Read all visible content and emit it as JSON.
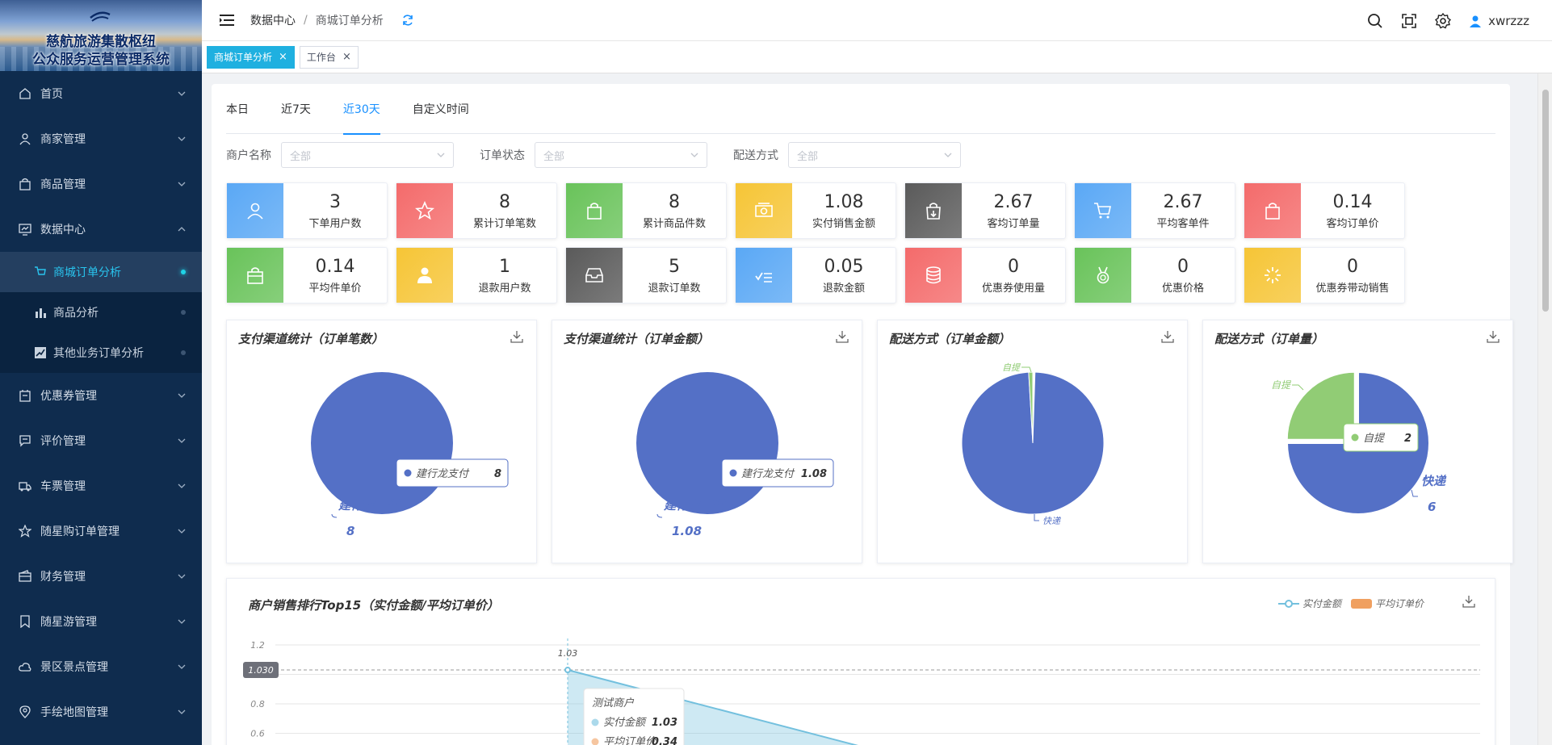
{
  "app": {
    "title_line1": "慈航旅游集散枢纽",
    "title_line2": "公众服务运营管理系统"
  },
  "sidebar": {
    "items": [
      {
        "label": "首页",
        "icon": "home-icon"
      },
      {
        "label": "商家管理",
        "icon": "user-icon"
      },
      {
        "label": "商品管理",
        "icon": "bag-icon"
      },
      {
        "label": "数据中心",
        "icon": "chart-icon",
        "expanded": true
      },
      {
        "label": "优惠券管理",
        "icon": "coupon-icon"
      },
      {
        "label": "评价管理",
        "icon": "comment-icon"
      },
      {
        "label": "车票管理",
        "icon": "truck-icon"
      },
      {
        "label": "随星购订单管理",
        "icon": "star-icon"
      },
      {
        "label": "财务管理",
        "icon": "wallet-icon"
      },
      {
        "label": "随星游管理",
        "icon": "bookmark-icon"
      },
      {
        "label": "景区景点管理",
        "icon": "cloud-icon"
      },
      {
        "label": "手绘地图管理",
        "icon": "location-icon"
      }
    ],
    "sub_items": [
      {
        "label": "商城订单分析",
        "active": true
      },
      {
        "label": "商品分析"
      },
      {
        "label": "其他业务订单分析"
      }
    ]
  },
  "header": {
    "breadcrumb_root": "数据中心",
    "breadcrumb_sep": "/",
    "breadcrumb_current": "商城订单分析",
    "username": "xwrzzz"
  },
  "tags": [
    {
      "label": "商城订单分析",
      "active": true,
      "close": "×"
    },
    {
      "label": "工作台",
      "active": false,
      "close": "×"
    }
  ],
  "tabs": [
    "本日",
    "近7天",
    "近30天",
    "自定义时间"
  ],
  "active_tab": "近30天",
  "filters": [
    {
      "label": "商户名称",
      "placeholder": "全部"
    },
    {
      "label": "订单状态",
      "placeholder": "全部"
    },
    {
      "label": "配送方式",
      "placeholder": "全部"
    }
  ],
  "stats": [
    {
      "value": "3",
      "name": "下单用户数",
      "color": "#5aa8f5",
      "icon": "user-icon"
    },
    {
      "value": "8",
      "name": "累计订单笔数",
      "color": "#f46b6b",
      "icon": "star-icon"
    },
    {
      "value": "8",
      "name": "累计商品件数",
      "color": "#69c35a",
      "icon": "bag-icon"
    },
    {
      "value": "1.08",
      "name": "实付销售金额",
      "color": "#f6c536",
      "icon": "money-icon"
    },
    {
      "value": "2.67",
      "name": "客均订单量",
      "color": "#5a5a5a",
      "icon": "bag-down-icon"
    },
    {
      "value": "2.67",
      "name": "平均客单件",
      "color": "#5aa8f5",
      "icon": "cart-icon"
    },
    {
      "value": "0.14",
      "name": "客均订单价",
      "color": "#f46b6b",
      "icon": "bag-icon"
    },
    {
      "value": "0.14",
      "name": "平均件单价",
      "color": "#69c35a",
      "icon": "shop-bag-icon"
    },
    {
      "value": "1",
      "name": "退款用户数",
      "color": "#f6c536",
      "icon": "person-icon"
    },
    {
      "value": "5",
      "name": "退款订单数",
      "color": "#5a5a5a",
      "icon": "inbox-icon"
    },
    {
      "value": "0.05",
      "name": "退款金额",
      "color": "#5aa8f5",
      "icon": "check-list-icon"
    },
    {
      "value": "0",
      "name": "优惠券使用量",
      "color": "#f46b6b",
      "icon": "database-icon"
    },
    {
      "value": "0",
      "name": "优惠价格",
      "color": "#69c35a",
      "icon": "medal-icon"
    },
    {
      "value": "0",
      "name": "优惠券带动销售",
      "color": "#f6c536",
      "icon": "loading-icon"
    }
  ],
  "chart_data": [
    {
      "type": "pie",
      "title": "支付渠道统计（订单笔数）",
      "slices": [
        {
          "name": "建行龙支付",
          "value": 8,
          "color": "#5470c6"
        }
      ],
      "tooltip": {
        "name": "建行龙支付",
        "value": "8"
      },
      "label": {
        "name": "建行龙支付",
        "value": "8"
      }
    },
    {
      "type": "pie",
      "title": "支付渠道统计（订单金额）",
      "slices": [
        {
          "name": "建行龙支付",
          "value": 1.08,
          "color": "#5470c6"
        }
      ],
      "tooltip": {
        "name": "建行龙支付",
        "value": "1.08"
      },
      "label": {
        "name": "建行龙支付",
        "value": "1.08"
      }
    },
    {
      "type": "pie",
      "title": "配送方式（订单金额）",
      "slices": [
        {
          "name": "快递",
          "value": 1.07,
          "color": "#5470c6"
        },
        {
          "name": "自提",
          "value": 0.01,
          "color": "#91cc75"
        }
      ]
    },
    {
      "type": "pie",
      "title": "配送方式（订单量）",
      "slices": [
        {
          "name": "快递",
          "value": 6,
          "color": "#5470c6"
        },
        {
          "name": "自提",
          "value": 2,
          "color": "#91cc75"
        }
      ],
      "tooltip": {
        "name": "自提",
        "value": "2"
      },
      "label": {
        "name": "快递",
        "value": "6"
      }
    },
    {
      "type": "line",
      "title": "商户销售排行Top15（实付金额/平均订单价）",
      "series": [
        {
          "name": "实付金额",
          "values": [
            1.03
          ],
          "color": "#73c0de"
        },
        {
          "name": "平均订单价",
          "values": [
            0.34
          ],
          "color": "#f0a060"
        }
      ],
      "categories": [
        "测试商户"
      ],
      "y_ticks": [
        "1.2",
        "0.8",
        "0.6"
      ],
      "y_pointer": "1.030",
      "point_label": "1.03",
      "tooltip": {
        "title": "测试商户",
        "rows": [
          {
            "name": "实付金额",
            "value": "1.03"
          },
          {
            "name": "平均订单价",
            "value": "0.34"
          }
        ]
      }
    }
  ]
}
